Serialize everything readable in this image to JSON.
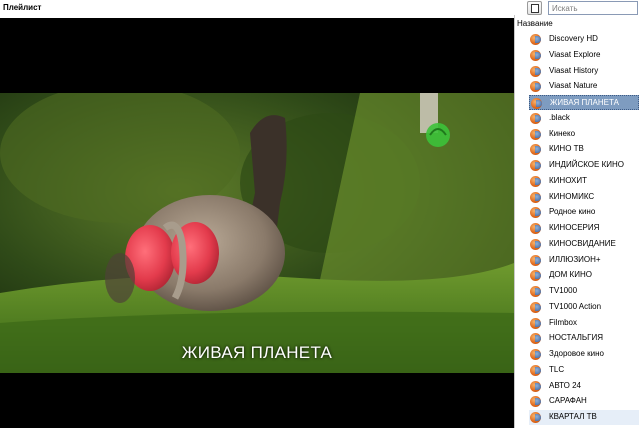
{
  "app": {
    "title": "Плейлист",
    "menu_icon": "playlist-menu-icon"
  },
  "search": {
    "placeholder": "Искать",
    "value": ""
  },
  "video": {
    "subtitle": "ЖИВАЯ ПЛАНЕТА",
    "channel_logo_icon": "zhivaya-planeta-logo-icon"
  },
  "playlist": {
    "column_header": "Название",
    "channel_icon": "channel-globe-icon",
    "selected_index": 4,
    "hover_index": 25,
    "items": [
      {
        "label": "Discovery HD"
      },
      {
        "label": "Viasat Explore"
      },
      {
        "label": "Viasat History"
      },
      {
        "label": "Viasat Nature"
      },
      {
        "label": "ЖИВАЯ ПЛАНЕТА"
      },
      {
        "label": ".black"
      },
      {
        "label": "Кинеко"
      },
      {
        "label": "КИНО ТВ"
      },
      {
        "label": "ИНДИЙСКОЕ КИНО"
      },
      {
        "label": "КИНОХИТ"
      },
      {
        "label": "КИНОМИКС"
      },
      {
        "label": "Родное кино"
      },
      {
        "label": "КИНОСЕРИЯ"
      },
      {
        "label": "КИНОСВИДАНИЕ"
      },
      {
        "label": "ИЛЛЮЗИОН+"
      },
      {
        "label": "ДОМ КИНО"
      },
      {
        "label": "TV1000"
      },
      {
        "label": "TV1000 Action"
      },
      {
        "label": "Filmbox"
      },
      {
        "label": "НОСТАЛЬГИЯ"
      },
      {
        "label": "Здоровое кино"
      },
      {
        "label": "TLC"
      },
      {
        "label": "АВТО 24"
      },
      {
        "label": "САРАФАН"
      },
      {
        "label": "КВАРТАЛ ТВ"
      }
    ]
  }
}
